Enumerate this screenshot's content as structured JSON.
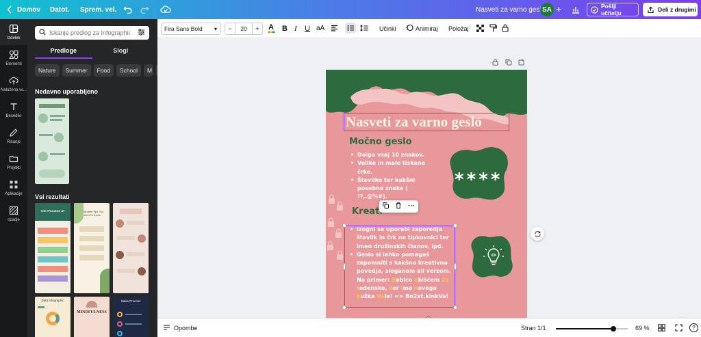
{
  "topbar": {
    "home": "Domov",
    "file": "Datot.",
    "saved": "Sprem. vel.",
    "doc_title": "Nasveti za varno geslo",
    "avatar": "SA",
    "send_teacher": "Pošlji učitelju",
    "share": "Deli z drugimi"
  },
  "leftrail": {
    "items": [
      {
        "label": "Izdelek",
        "icon": "layout-icon"
      },
      {
        "label": "Elementi",
        "icon": "shapes-icon"
      },
      {
        "label": "Naložena vs...",
        "icon": "cloud-upload-icon"
      },
      {
        "label": "Besedilo",
        "icon": "text-icon"
      },
      {
        "label": "Risanje",
        "icon": "pencil-icon"
      },
      {
        "label": "Projekti",
        "icon": "folder-icon"
      },
      {
        "label": "Aplikacije",
        "icon": "apps-icon"
      },
      {
        "label": "ozadje",
        "icon": "pattern-icon"
      }
    ]
  },
  "panel": {
    "search_placeholder": "Iskanje predlog za Infographic",
    "tabs": [
      "Predloge",
      "Slogi"
    ],
    "chips": [
      "Nature",
      "Summer",
      "Food",
      "School",
      "M"
    ],
    "recent_title": "Nedavno uporabljeno",
    "all_title": "Vsi rezultati",
    "thumbs": {
      "t1": "THE PROCESS OF",
      "t2": "5 Valuable Tips You Need To Know",
      "t3": "Data Infographic",
      "t4": "MINDFULNESS",
      "t5": "Sales Process"
    }
  },
  "toolbar": {
    "font": "Fira Sans Bold",
    "font_size": "20",
    "effects": "Učinki",
    "animate": "Animiraj",
    "position": "Položaj"
  },
  "page": {
    "title": "Nasveti za varno geslo",
    "heading1": "Močno geslo",
    "list1": [
      "Dolgo vsaj 10 znakov.",
      "Velike in male tiskane črke.",
      "Številke ter kakšni posebne znake ( !?,.@%#)."
    ],
    "stars": "****",
    "heading2": "Kreati",
    "list2_item1": "Izogni se uporabi zaporedja številk in črk na tipkovnici ter imen družinskih članov, ipd.",
    "list2_item2_pre": "Geslo si lahko pomagaš zapomniti s kakšno kreativno povedjo, sloganom ali verzom. Na primer: ",
    "example_parts": [
      {
        "t": "B",
        "h": true
      },
      {
        "t": "abico ",
        "h": false
      },
      {
        "t": "o",
        "h": true
      },
      {
        "t": "biščem ",
        "h": false
      },
      {
        "t": "2x",
        "h": true
      },
      {
        "t": " ",
        "h": false
      },
      {
        "t": "t",
        "h": true
      },
      {
        "t": "edensko, ",
        "h": false
      },
      {
        "t": "k",
        "h": true
      },
      {
        "t": "er ",
        "h": false
      },
      {
        "t": "i",
        "h": true
      },
      {
        "t": "ma ",
        "h": false
      },
      {
        "t": "n",
        "h": true
      },
      {
        "t": "ovega ",
        "h": false
      },
      {
        "t": "k",
        "h": true
      },
      {
        "t": "užka ",
        "h": false
      },
      {
        "t": "Va",
        "h": true
      },
      {
        "t": "le! ",
        "h": false
      }
    ],
    "example_result": "=>  Bo2xt,kinkVa!"
  },
  "status": {
    "notes": "Opombe",
    "page_count": "Stran 1/1",
    "zoom": "69 %",
    "zoom_level": 0.69
  },
  "colors": {
    "accent": "#8b3dff",
    "page_bg": "#e8979a",
    "dark_green": "#2d6b3f",
    "light_pink": "#f4c4c4",
    "highlight": "#f6c84a"
  }
}
